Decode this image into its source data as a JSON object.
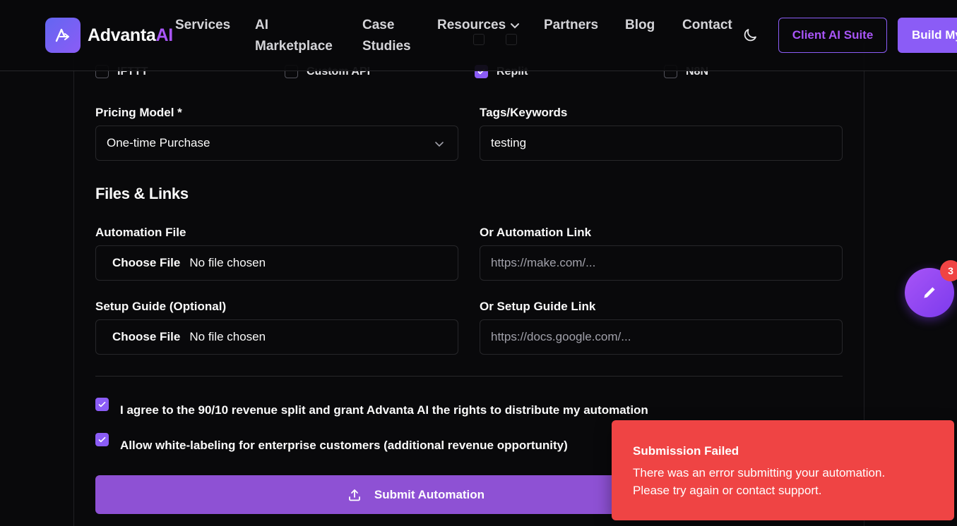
{
  "header": {
    "brand": {
      "name": "Advanta",
      "suffix": "AI"
    },
    "nav": [
      {
        "label": "Services"
      },
      {
        "label": "AI",
        "label2": "Marketplace"
      },
      {
        "label": "Case",
        "label2": "Studies"
      },
      {
        "label": "Resources"
      },
      {
        "label": "Partners"
      },
      {
        "label": "Blog"
      },
      {
        "label": "Contact"
      }
    ],
    "client_suite_label": "Client AI Suite",
    "build_label": "Build My"
  },
  "platforms": [
    {
      "label": "IFTTT",
      "checked": false
    },
    {
      "label": "Custom API",
      "checked": false
    },
    {
      "label": "Replit",
      "checked": true
    },
    {
      "label": "N8N",
      "checked": false
    }
  ],
  "form": {
    "pricing_label": "Pricing Model *",
    "pricing_value": "One-time Purchase",
    "tags_label": "Tags/Keywords",
    "tags_value": "testing",
    "files_section_title": "Files & Links",
    "automation_file_label": "Automation File",
    "automation_link_label": "Or Automation Link",
    "automation_link_placeholder": "https://make.com/...",
    "setup_guide_label": "Setup Guide (Optional)",
    "setup_link_label": "Or Setup Guide Link",
    "setup_link_placeholder": "https://docs.google.com/...",
    "choose_file_label": "Choose File",
    "no_file_label": "No file chosen",
    "agree_revenue": "I agree to the 90/10 revenue split and grant Advanta AI the rights to distribute my automation",
    "agree_whitelabel": "Allow white-labeling for enterprise customers (additional revenue opportunity)",
    "submit_label": "Submit Automation"
  },
  "fab": {
    "badge_count": "3"
  },
  "toast": {
    "title": "Submission Failed",
    "description": "There was an error submitting your automation. Please try again or contact support."
  },
  "colors": {
    "accent": "#8b5cf6",
    "error": "#ef4444",
    "background": "#09090b"
  }
}
